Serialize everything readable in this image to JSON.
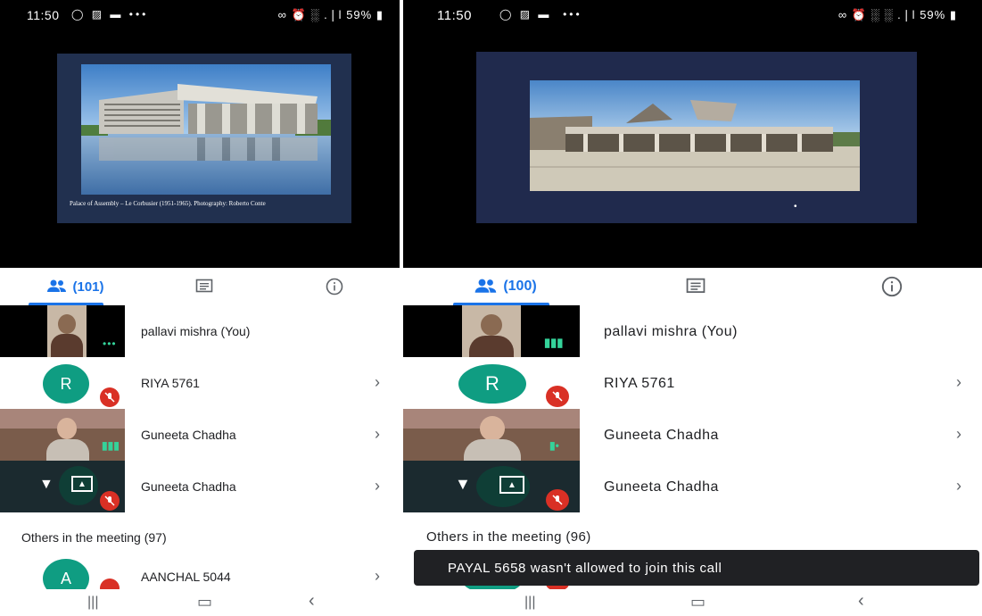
{
  "left": {
    "status": {
      "time": "11:50",
      "battery": "59%",
      "left_icons": "◯ ▨ ▬  •••",
      "right_icons": "∞ ⏰ ░ .❘l"
    },
    "slide": {
      "caption": "Palace of Assembly – Le Corbusier (1951-1965). Photography: Roberto Conte"
    },
    "tabs": {
      "people_count": "(101)"
    },
    "participants": [
      {
        "name": "pallavi mishra (You)"
      },
      {
        "name": "RIYA 5761",
        "initial": "R"
      },
      {
        "name": "Guneeta Chadha"
      },
      {
        "name": "Guneeta Chadha"
      }
    ],
    "others_header": "Others in the meeting (97)",
    "others": [
      {
        "name": "AANCHAL 5044",
        "initial": "A"
      }
    ]
  },
  "right": {
    "status": {
      "time": "11:50",
      "battery": "59%",
      "right_icons": "∞ ⏰ ░ ░ .❘l"
    },
    "tabs": {
      "people_count": "(100)"
    },
    "participants": [
      {
        "name": "pallavi mishra (You)"
      },
      {
        "name": "RIYA 5761",
        "initial": "R"
      },
      {
        "name": "Guneeta Chadha"
      },
      {
        "name": "Guneeta Chadha"
      }
    ],
    "others_header": "Others in the meeting (96)",
    "toast": "PAYAL 5658 wasn't allowed to join this call"
  },
  "colors": {
    "accent": "#1a73e8",
    "avatar_green": "#0f9d82",
    "mic_red": "#d93025"
  }
}
